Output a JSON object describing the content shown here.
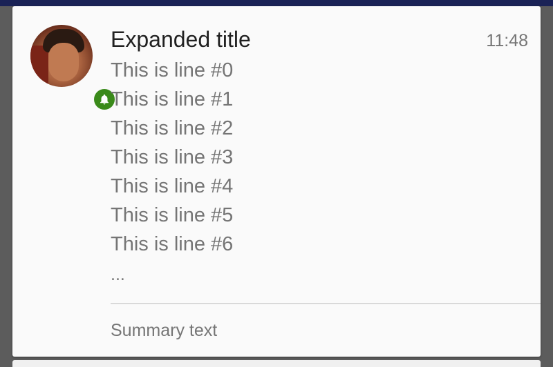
{
  "notification": {
    "title": "Expanded title",
    "time": "11:48",
    "lines": [
      "This is line #0",
      "This is line #1",
      "This is line #2",
      "This is line #3",
      "This is line #4",
      "This is line #5",
      "This is line #6"
    ],
    "ellipsis": "...",
    "summary": "Summary text",
    "badge_icon": "bell-icon",
    "badge_color": "#3a8a1a"
  }
}
